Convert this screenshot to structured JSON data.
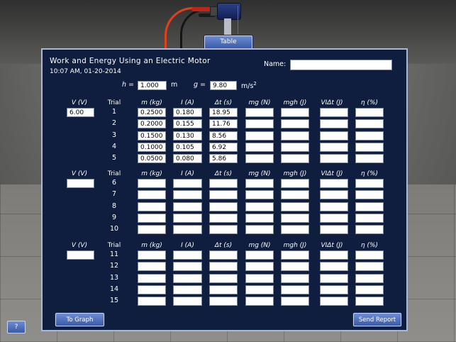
{
  "scene": {
    "table_button": "Table",
    "help_button": "?"
  },
  "panel": {
    "title": "Work and Energy Using an Electric Motor",
    "datetime": "10:07 AM, 01-20-2014",
    "name_label": "Name:",
    "name_value": "",
    "h_label": "h =",
    "h_value": "1.000",
    "h_unit": "m",
    "g_label": "g =",
    "g_value": "9.80",
    "g_unit": "m/s",
    "g_unit_exp": "2",
    "to_graph": "To Graph",
    "send_report": "Send Report"
  },
  "columns": {
    "v": "V (V)",
    "trial": "Trial",
    "m": "m (kg)",
    "i": "I (A)",
    "dt": "Δt (s)",
    "mg": "mg (N)",
    "mgh": "mgh (J)",
    "vidt": "VIΔt (J)",
    "eta": "η (%)"
  },
  "groups": [
    {
      "voltage": "6.00",
      "trials": [
        {
          "trial": "1",
          "m": "0.2500",
          "i": "0.180",
          "dt": "18.95",
          "mg": "",
          "mgh": "",
          "vidt": "",
          "eta": ""
        },
        {
          "trial": "2",
          "m": "0.2000",
          "i": "0.155",
          "dt": "11.76",
          "mg": "",
          "mgh": "",
          "vidt": "",
          "eta": ""
        },
        {
          "trial": "3",
          "m": "0.1500",
          "i": "0.130",
          "dt": "8.56",
          "mg": "",
          "mgh": "",
          "vidt": "",
          "eta": ""
        },
        {
          "trial": "4",
          "m": "0.1000",
          "i": "0.105",
          "dt": "6.92",
          "mg": "",
          "mgh": "",
          "vidt": "",
          "eta": ""
        },
        {
          "trial": "5",
          "m": "0.0500",
          "i": "0.080",
          "dt": "5.86",
          "mg": "",
          "mgh": "",
          "vidt": "",
          "eta": ""
        }
      ]
    },
    {
      "voltage": "",
      "trials": [
        {
          "trial": "6",
          "m": "",
          "i": "",
          "dt": "",
          "mg": "",
          "mgh": "",
          "vidt": "",
          "eta": ""
        },
        {
          "trial": "7",
          "m": "",
          "i": "",
          "dt": "",
          "mg": "",
          "mgh": "",
          "vidt": "",
          "eta": ""
        },
        {
          "trial": "8",
          "m": "",
          "i": "",
          "dt": "",
          "mg": "",
          "mgh": "",
          "vidt": "",
          "eta": ""
        },
        {
          "trial": "9",
          "m": "",
          "i": "",
          "dt": "",
          "mg": "",
          "mgh": "",
          "vidt": "",
          "eta": ""
        },
        {
          "trial": "10",
          "m": "",
          "i": "",
          "dt": "",
          "mg": "",
          "mgh": "",
          "vidt": "",
          "eta": ""
        }
      ]
    },
    {
      "voltage": "",
      "trials": [
        {
          "trial": "11",
          "m": "",
          "i": "",
          "dt": "",
          "mg": "",
          "mgh": "",
          "vidt": "",
          "eta": ""
        },
        {
          "trial": "12",
          "m": "",
          "i": "",
          "dt": "",
          "mg": "",
          "mgh": "",
          "vidt": "",
          "eta": ""
        },
        {
          "trial": "13",
          "m": "",
          "i": "",
          "dt": "",
          "mg": "",
          "mgh": "",
          "vidt": "",
          "eta": ""
        },
        {
          "trial": "14",
          "m": "",
          "i": "",
          "dt": "",
          "mg": "",
          "mgh": "",
          "vidt": "",
          "eta": ""
        },
        {
          "trial": "15",
          "m": "",
          "i": "",
          "dt": "",
          "mg": "",
          "mgh": "",
          "vidt": "",
          "eta": ""
        }
      ]
    }
  ]
}
